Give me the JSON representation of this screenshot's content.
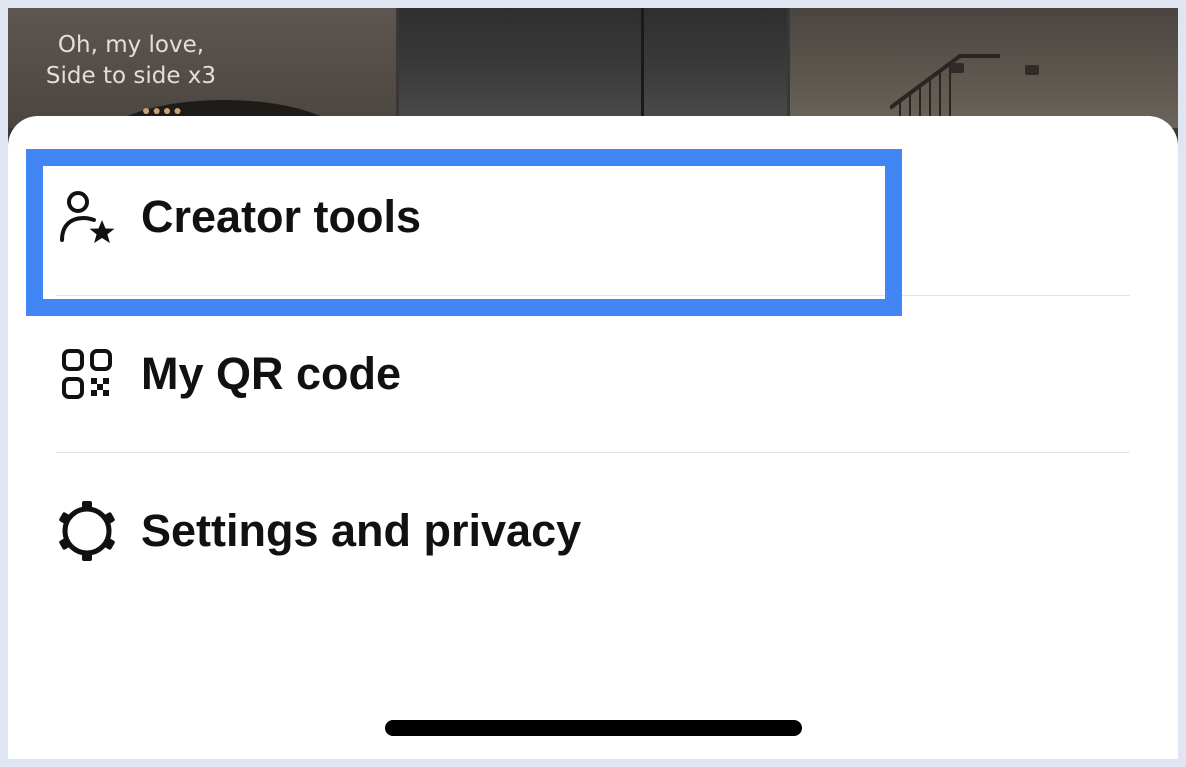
{
  "background_thumbnails": [
    {
      "name": "video-thumbnail-1",
      "caption": "Oh, my love,\nSide to side x3",
      "decoration": "●●●●"
    },
    {
      "name": "video-thumbnail-2"
    },
    {
      "name": "video-thumbnail-3"
    }
  ],
  "menu": {
    "items": [
      {
        "id": "creator-tools",
        "icon": "person-star-icon",
        "label": "Creator tools",
        "highlighted": true
      },
      {
        "id": "my-qr-code",
        "icon": "qr-code-icon",
        "label": "My QR code"
      },
      {
        "id": "settings-and-privacy",
        "icon": "gear-icon",
        "label": "Settings and privacy"
      }
    ]
  },
  "colors": {
    "highlight": "#4285f4",
    "sheet": "#ffffff",
    "text": "#111111",
    "divider": "#e3e3e3",
    "home_indicator": "#000000"
  }
}
